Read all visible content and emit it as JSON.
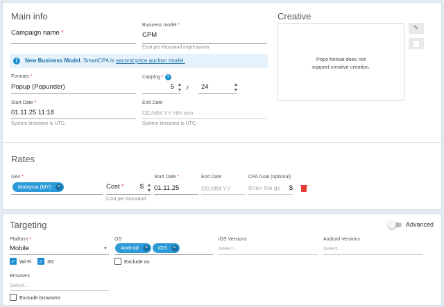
{
  "main_info": {
    "title": "Main info",
    "campaign_name": {
      "label": "Campaign name",
      "required": "*",
      "value": ""
    },
    "business_model": {
      "label": "Business model",
      "required": "*",
      "value": "CPM",
      "hint": "Cost per thousand impressions"
    },
    "notice": {
      "bold": "New Business Model.",
      "text": " SmartCPA is ",
      "link": "second price auction model."
    },
    "formats": {
      "label": "Formats",
      "required": "*",
      "value": "Popup (Popunder)"
    },
    "capping": {
      "label": "Capping",
      "required": "*",
      "count": "5",
      "separator": "/",
      "period": "24"
    },
    "start_date": {
      "label": "Start Date",
      "required": "*",
      "value": "01.11.25 11:18",
      "hint": "System timezone is UTC."
    },
    "end_date": {
      "label": "End Date",
      "placeholder": "DD.MM.YY HH:mm",
      "hint": "System timezone is UTC."
    }
  },
  "creative": {
    "title": "Creative",
    "message_line1": "Pops format does not",
    "message_line2": "support creative creation."
  },
  "rates": {
    "title": "Rates",
    "geo_label": "Geo",
    "geo_required": "*",
    "geo_chip": "Malaysia (MY)",
    "cost_label": "Cost",
    "cost_required": "*",
    "currency": "$",
    "cost_hint": "Cost per thousand",
    "start_label": "Start Date",
    "start_required": "*",
    "start_value": "01.11.25",
    "end_label": "End Date",
    "end_placeholder": "DD.MM.YY",
    "cpa_label": "CPA Goal (optional)",
    "cpa_placeholder": "Enter the go",
    "cpa_currency": "$"
  },
  "targeting": {
    "title": "Targeting",
    "advanced_label": "Advanced",
    "platform": {
      "label": "Platform",
      "required": "*",
      "value": "Mobile"
    },
    "wifi_label": "Wi-Fi",
    "g3_label": "3G",
    "os": {
      "label": "OS",
      "chips": [
        "Android",
        "iOS"
      ],
      "exclude_label": "Exclude os"
    },
    "ios_versions": {
      "label": "iOS Versions",
      "placeholder": "Select..."
    },
    "android_versions": {
      "label": "Android Versions",
      "placeholder": "Select..."
    },
    "browsers": {
      "label": "Browsers",
      "placeholder": "Select...",
      "exclude_label": "Exclude browsers"
    }
  },
  "colors": {
    "accent": "#1d8fd0",
    "chip": "#2d9bd8",
    "notice_bg": "#e5f2fb",
    "delete": "#e53935"
  }
}
